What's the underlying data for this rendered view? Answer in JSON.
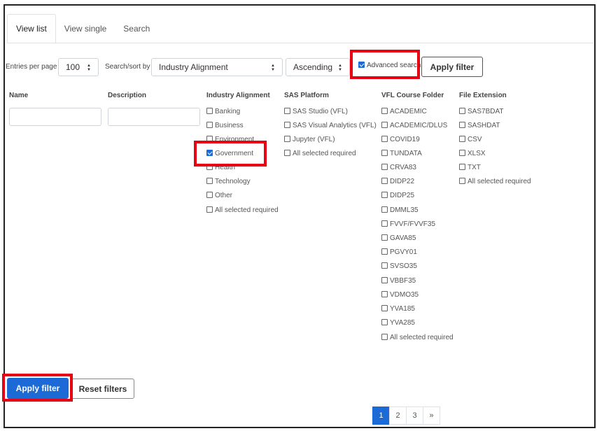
{
  "tabs": [
    "View list",
    "View single",
    "Search"
  ],
  "filter_bar": {
    "entries_label": "Entries per page",
    "entries_value": "100",
    "sort_label": "Search/sort by",
    "sort_value": "Industry Alignment",
    "order_value": "Ascending",
    "advanced_label": "Advanced search",
    "apply_label": "Apply filter"
  },
  "columns": {
    "name": "Name",
    "description": "Description",
    "industry": {
      "title": "Industry Alignment",
      "options": [
        "Banking",
        "Business",
        "Environment",
        "Government",
        "Health",
        "Technology",
        "Other",
        "All selected required"
      ],
      "checked": "Government"
    },
    "platform": {
      "title": "SAS Platform",
      "options": [
        "SAS Studio (VFL)",
        "SAS Visual Analytics (VFL)",
        "Jupyter (VFL)",
        "All selected required"
      ]
    },
    "folder": {
      "title": "VFL Course Folder",
      "options": [
        "ACADEMIC",
        "ACADEMIC/DLUS",
        "COVID19",
        "TUNDATA",
        "CRVA83",
        "DIDP22",
        "DIDP25",
        "DMML35",
        "FVVF/FVVF35",
        "GAVA85",
        "PGVY01",
        "SVSO35",
        "VBBF35",
        "VDMO35",
        "YVA185",
        "YVA285",
        "All selected required"
      ]
    },
    "extension": {
      "title": "File Extension",
      "options": [
        "SAS7BDAT",
        "SASHDAT",
        "CSV",
        "XLSX",
        "TXT",
        "All selected required"
      ]
    }
  },
  "footer": {
    "apply_label": "Apply filter",
    "reset_label": "Reset filters"
  },
  "pagination": [
    "1",
    "2",
    "3",
    "»"
  ],
  "colors": {
    "primary": "#1c6ad6",
    "highlight": "#e60012"
  }
}
